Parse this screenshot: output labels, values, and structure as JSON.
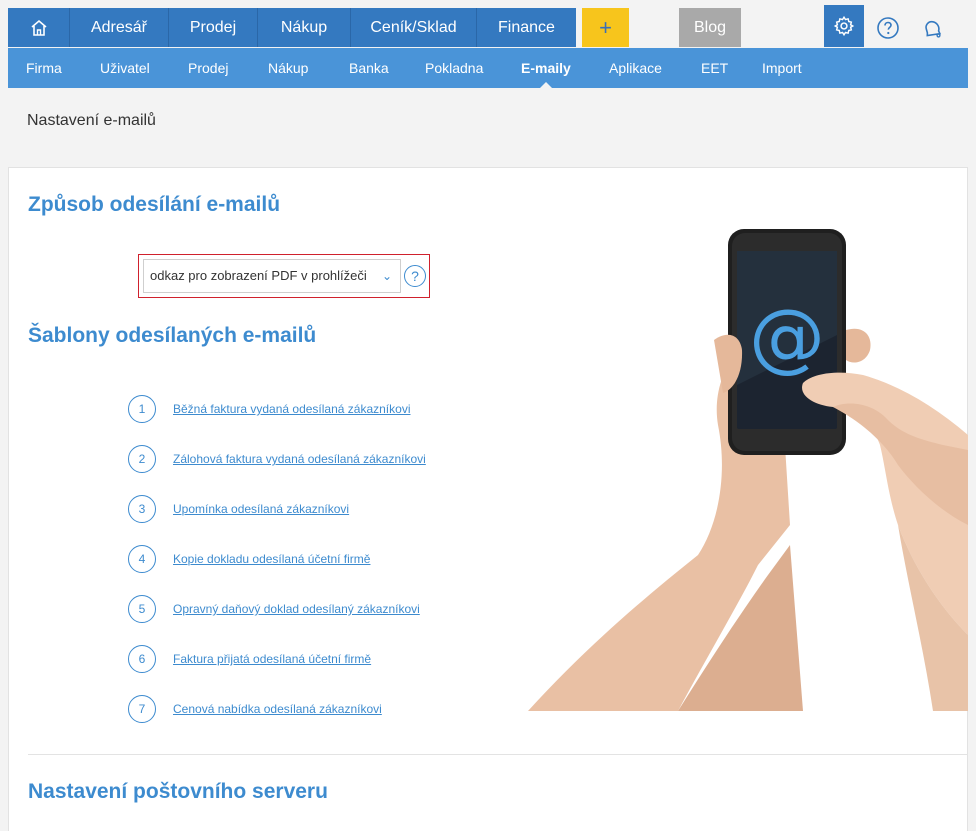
{
  "topnav": {
    "items": [
      "Adresář",
      "Prodej",
      "Nákup",
      "Ceník/Sklad",
      "Finance"
    ],
    "plus": "+",
    "blog": "Blog",
    "icons": [
      "home-icon",
      "gear-icon",
      "help-icon",
      "bell-icon"
    ]
  },
  "subnav": {
    "items": [
      "Firma",
      "Uživatel",
      "Prodej",
      "Nákup",
      "Banka",
      "Pokladna",
      "E-maily",
      "Aplikace",
      "EET",
      "Import"
    ],
    "active": "E-maily"
  },
  "page": {
    "title": "Nastavení e-mailů"
  },
  "sending": {
    "heading": "Způsob odesílání e-mailů",
    "selected": "odkaz pro zobrazení PDF v prohlížeči",
    "help": "?"
  },
  "templates": {
    "heading": "Šablony odesílaných e-mailů",
    "items": [
      {
        "num": "1",
        "label": "Běžná faktura vydaná odesílaná zákazníkovi"
      },
      {
        "num": "2",
        "label": "Zálohová faktura vydaná odesílaná zákazníkovi"
      },
      {
        "num": "3",
        "label": "Upomínka odesílaná zákazníkovi"
      },
      {
        "num": "4",
        "label": "Kopie dokladu odesílaná účetní firmě"
      },
      {
        "num": "5",
        "label": "Opravný daňový doklad odesílaný zákazníkovi"
      },
      {
        "num": "6",
        "label": "Faktura přijatá odesílaná účetní firmě"
      },
      {
        "num": "7",
        "label": "Cenová nabídka odesílaná zákazníkovi"
      }
    ]
  },
  "mailserver": {
    "heading": "Nastavení poštovního serveru"
  },
  "illustration": {
    "symbol": "@"
  },
  "colors": {
    "primary": "#3479c0",
    "secondary": "#4a94d8",
    "accent": "#f7c51c",
    "link": "#3d8bcf",
    "highlight": "#d0212d"
  }
}
